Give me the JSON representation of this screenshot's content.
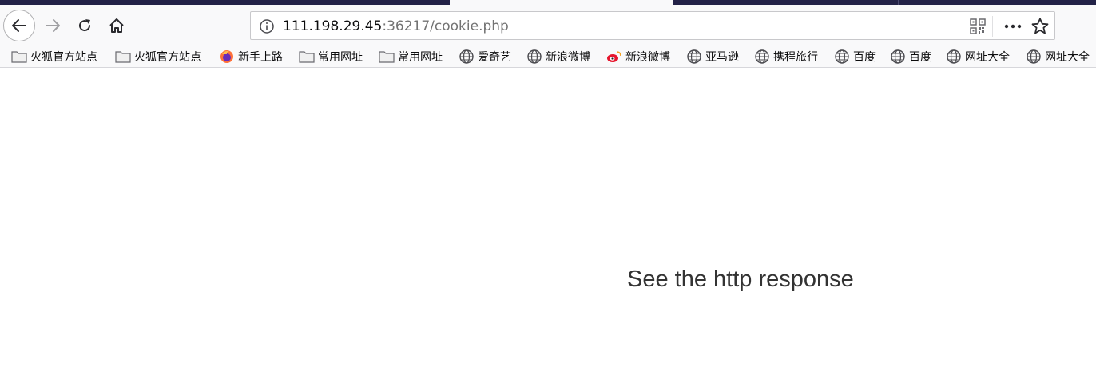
{
  "toolbar": {
    "back_icon": "back-arrow-icon",
    "forward_icon": "forward-arrow-icon",
    "reload_icon": "reload-icon",
    "home_icon": "home-icon"
  },
  "urlbar": {
    "host": "111.198.29.45",
    "rest": ":36217/cookie.php",
    "info_icon": "info-icon",
    "qr_icon": "qr-code-icon",
    "more_icon": "more-dots-icon",
    "star_icon": "bookmark-star-icon"
  },
  "bookmarks": [
    {
      "label": "火狐官方站点",
      "icon": "folder-icon"
    },
    {
      "label": "火狐官方站点",
      "icon": "folder-icon"
    },
    {
      "label": "新手上路",
      "icon": "firefox-icon"
    },
    {
      "label": "常用网址",
      "icon": "folder-icon"
    },
    {
      "label": "常用网址",
      "icon": "folder-icon"
    },
    {
      "label": "爱奇艺",
      "icon": "globe-icon"
    },
    {
      "label": "新浪微博",
      "icon": "globe-icon"
    },
    {
      "label": "新浪微博",
      "icon": "weibo-icon"
    },
    {
      "label": "亚马逊",
      "icon": "globe-icon"
    },
    {
      "label": "携程旅行",
      "icon": "globe-icon"
    },
    {
      "label": "百度",
      "icon": "globe-icon"
    },
    {
      "label": "百度",
      "icon": "globe-icon"
    },
    {
      "label": "网址大全",
      "icon": "globe-icon"
    },
    {
      "label": "网址大全",
      "icon": "globe-icon"
    }
  ],
  "page": {
    "message": "See the http response"
  },
  "colors": {
    "tabstrip": "#232247",
    "toolbar": "#f9f9fa",
    "text": "#333333"
  }
}
